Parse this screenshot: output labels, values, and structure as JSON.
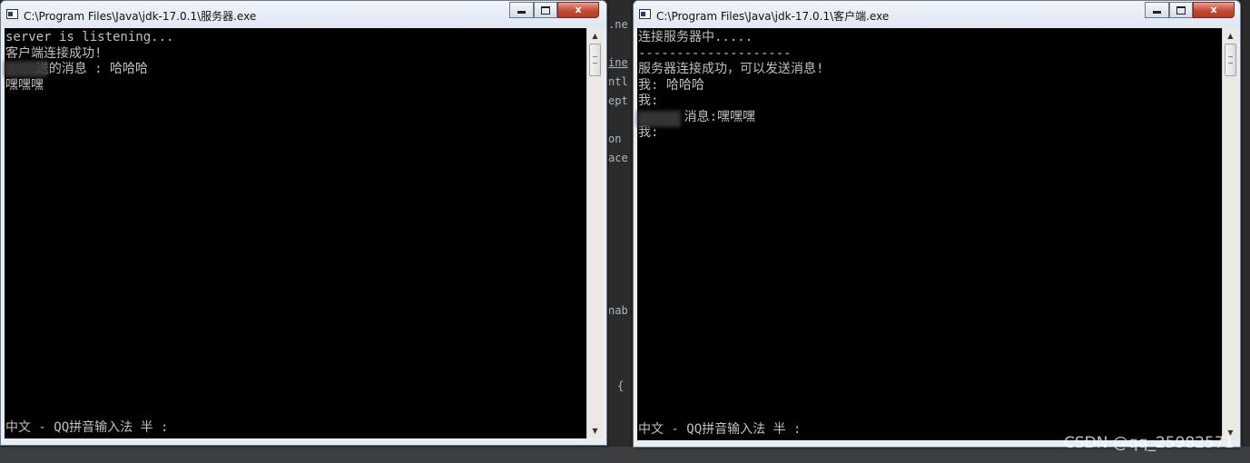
{
  "ide_background": {
    "fragments": [
      ".ne",
      "ine",
      "ntl",
      "ept",
      "on",
      "ace",
      "nab",
      "{"
    ]
  },
  "server_window": {
    "title": "C:\\Program Files\\Java\\jdk-17.0.1\\服务器.exe",
    "lines": [
      "server is listening...",
      "客户端连接成功!",
      "    送的消息 : 哈哈哈",
      "嘿嘿嘿"
    ],
    "ime_status": "中文 - QQ拼音输入法 半 :",
    "controls": {
      "minimize": "minimize",
      "maximize": "maximize",
      "close": "x"
    }
  },
  "client_window": {
    "title": "C:\\Program Files\\Java\\jdk-17.0.1\\客户端.exe",
    "lines": [
      "连接服务器中.....",
      "--------------------",
      "服务器连接成功，可以发送消息!",
      "我: 哈哈哈",
      "我:",
      "      消息:嘿嘿嘿",
      "我:"
    ],
    "ime_status": "中文 - QQ拼音输入法 半 :",
    "controls": {
      "minimize": "minimize",
      "maximize": "maximize",
      "close": "x"
    }
  },
  "icons": {
    "window_icon": "console-window-icon",
    "scroll_up": "▲",
    "scroll_down": "▼"
  },
  "watermark": "CSDN @qq_25982571",
  "colors": {
    "console_bg": "#000000",
    "console_text": "#c0c0c0",
    "close_button": "#c24a33"
  }
}
